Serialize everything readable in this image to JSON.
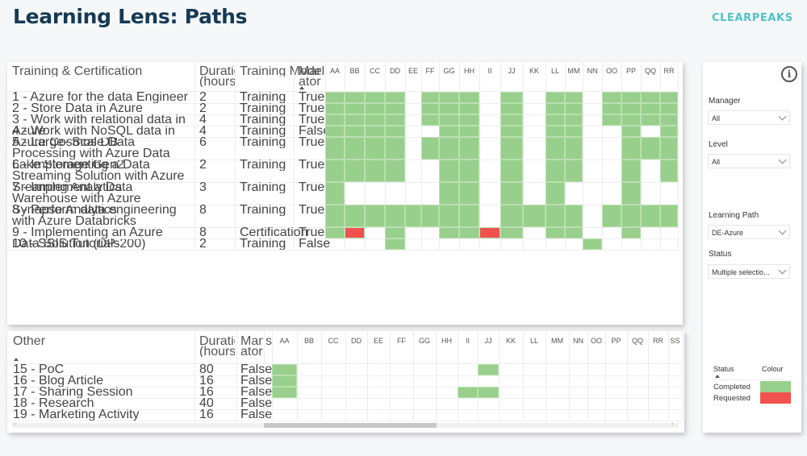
{
  "header": {
    "title": "Learning Lens: Paths",
    "logo": "CLEARPEAKS"
  },
  "colors": {
    "completed": "#98cf8c",
    "requested": "#f0524f",
    "title": "#163a55",
    "logo": "#4fc3c7"
  },
  "top_table": {
    "headers": {
      "name": "Training & Certification",
      "duration": "Duration (hours)",
      "model": "Training Model",
      "mandatory": "Mand atory"
    },
    "columns": [
      "AA",
      "BB",
      "CC",
      "DD",
      "EE",
      "FF",
      "GG",
      "HH",
      "II",
      "JJ",
      "KK",
      "LL",
      "MM",
      "NN",
      "OO",
      "PP",
      "QQ",
      "RR"
    ],
    "rows": [
      {
        "name": "1 - Azure for the data Engineer",
        "duration": "2",
        "model": "Training",
        "mandatory": "True",
        "completed": [
          "AA",
          "BB",
          "CC",
          "DD",
          "FF",
          "GG",
          "HH",
          "JJ",
          "LL",
          "MM",
          "OO",
          "PP",
          "QQ",
          "RR"
        ],
        "requested": []
      },
      {
        "name": "2 - Store Data in Azure",
        "duration": "2",
        "model": "Training",
        "mandatory": "True",
        "completed": [
          "AA",
          "BB",
          "CC",
          "DD",
          "FF",
          "GG",
          "HH",
          "JJ",
          "LL",
          "MM",
          "OO",
          "PP",
          "QQ",
          "RR"
        ],
        "requested": []
      },
      {
        "name": "3 - Work with relational data in Azure",
        "duration": "4",
        "model": "Training",
        "mandatory": "True",
        "completed": [
          "AA",
          "BB",
          "CC",
          "DD",
          "FF",
          "GG",
          "HH",
          "JJ",
          "LL",
          "MM",
          "OO",
          "PP",
          "QQ",
          "RR"
        ],
        "requested": []
      },
      {
        "name": "4 - Work with NoSQL data in Azure Cosmos DB",
        "duration": "4",
        "model": "Training",
        "mandatory": "False",
        "completed": [
          "AA",
          "BB",
          "CC",
          "DD",
          "GG",
          "HH",
          "JJ",
          "LL",
          "MM",
          "PP",
          "RR"
        ],
        "requested": []
      },
      {
        "name": "5 - Large- Scale Data Processing with Azure Data Lake Storage Gen2",
        "duration": "6",
        "model": "Training",
        "mandatory": "True",
        "completed": [
          "AA",
          "BB",
          "CC",
          "DD",
          "FF",
          "GG",
          "HH",
          "JJ",
          "LL",
          "MM",
          "PP",
          "QQ",
          "RR"
        ],
        "requested": []
      },
      {
        "name": "6 - Implementing a Data Streaming Solution with Azure Sreaming Analytics",
        "duration": "2",
        "model": "Training",
        "mandatory": "True",
        "completed": [
          "AA",
          "BB",
          "CC",
          "DD",
          "GG",
          "HH",
          "JJ",
          "LL",
          "MM",
          "PP",
          "RR"
        ],
        "requested": []
      },
      {
        "name": "7 - Implement a Data Warehouse with Azure Synapse Analytics",
        "duration": "3",
        "model": "Training",
        "mandatory": "True",
        "completed": [
          "AA",
          "GG",
          "HH",
          "JJ",
          "LL",
          "PP"
        ],
        "requested": []
      },
      {
        "name": "8 - Perform data engineering with Azure Databricks",
        "duration": "8",
        "model": "Training",
        "mandatory": "True",
        "completed": [
          "AA",
          "BB",
          "CC",
          "DD",
          "EE",
          "FF",
          "GG",
          "HH",
          "JJ",
          "KK",
          "LL",
          "MM",
          "OO",
          "PP",
          "QQ",
          "RR"
        ],
        "requested": []
      },
      {
        "name": "9 - Implementing an Azure Data Solution (DP-200)",
        "duration": "8",
        "model": "Certification",
        "mandatory": "True",
        "completed": [
          "AA",
          "DD",
          "GG",
          "HH",
          "JJ",
          "LL",
          "MM",
          "PP"
        ],
        "requested": [
          "BB",
          "II"
        ]
      },
      {
        "name": "10 - SSIS Tutorials",
        "duration": "2",
        "model": "Training",
        "mandatory": "False",
        "completed": [
          "DD",
          "NN"
        ],
        "requested": []
      }
    ]
  },
  "bottom_table": {
    "headers": {
      "name": "Other",
      "duration": "Duration (hours)",
      "mandatory": "Mand atory",
      "truncated": "s"
    },
    "columns": [
      "AA",
      "BB",
      "CC",
      "DD",
      "EE",
      "FF",
      "GG",
      "HH",
      "II",
      "JJ",
      "KK",
      "LL",
      "MM",
      "NN",
      "OO",
      "PP",
      "QQ",
      "RR",
      "SS"
    ],
    "rows": [
      {
        "name": "15 - PoC",
        "duration": "80",
        "mandatory": "False",
        "completed": [
          "AA",
          "JJ"
        ],
        "requested": []
      },
      {
        "name": "16 - Blog Article",
        "duration": "16",
        "mandatory": "False",
        "completed": [
          "AA"
        ],
        "requested": []
      },
      {
        "name": "17 - Sharing Session",
        "duration": "16",
        "mandatory": "False",
        "completed": [
          "AA",
          "II",
          "JJ"
        ],
        "requested": []
      },
      {
        "name": "18 - Research",
        "duration": "40",
        "mandatory": "False",
        "completed": [],
        "requested": []
      },
      {
        "name": "19 - Marketing Activity",
        "duration": "16",
        "mandatory": "False",
        "completed": [],
        "requested": []
      }
    ],
    "scroll": {
      "left_arrow": "‹",
      "right_arrow": "›",
      "position_fraction": 0.51,
      "visible_fraction": 0.26
    }
  },
  "filters": {
    "info_icon": "i",
    "manager": {
      "label": "Manager",
      "value": "All"
    },
    "level": {
      "label": "Level",
      "value": "All"
    },
    "learning_path": {
      "label": "Learning Path",
      "value": "DE-Azure"
    },
    "status": {
      "label": "Status",
      "value": "Multiple selectio..."
    }
  },
  "legend": {
    "headers": {
      "status": "Status",
      "colour": "Colour"
    },
    "items": [
      {
        "label": "Completed",
        "color": "#98cf8c"
      },
      {
        "label": "Requested",
        "color": "#f0524f"
      }
    ]
  }
}
